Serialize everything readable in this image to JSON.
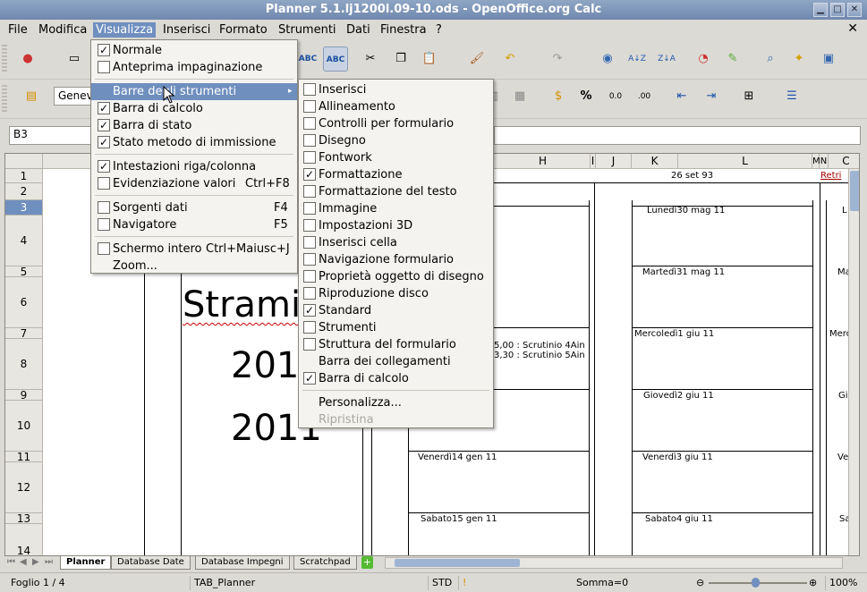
{
  "window": {
    "title": "Planner 5.1.lj1200l.09-10.ods - OpenOffice.org Calc"
  },
  "menubar": {
    "items": [
      "File",
      "Modifica",
      "Visualizza",
      "Inserisci",
      "Formato",
      "Strumenti",
      "Dati",
      "Finestra",
      "?"
    ]
  },
  "formula": {
    "cell_ref": "B3"
  },
  "font_box": {
    "value": "Genev"
  },
  "columns": [
    "H",
    "I",
    "J",
    "K",
    "L",
    "M",
    "N",
    "C"
  ],
  "rows": [
    "1",
    "2",
    "3",
    "4",
    "5",
    "6",
    "7",
    "8",
    "9",
    "10",
    "11",
    "12",
    "13",
    "14"
  ],
  "cells": {
    "date_header": "26 set 93",
    "retri": "Retri",
    "big_text": "Stramin",
    "year1": "2010",
    "year2": "2011",
    "lunedi": "Lunedì30 mag 11",
    "martedi": "Martedì31 mag 11",
    "mercoledi": "Mercoledì1 giu 11",
    "giovedi": "Giovedì2 giu 11",
    "venerdi": "Venerdì3 giu 11",
    "sabato": "Sabato4 giu 11",
    "venerdi_gen": "Venerdì14 gen 11",
    "sabato_gen": "Sabato15 gen 11",
    "scrutinio1": "5,00 : Scrutinio 4Ain",
    "scrutinio2": "3,30 : Scrutinio 5Ain",
    "col_edge": [
      "L",
      "Ma",
      "Merc",
      "Gi",
      "Ve",
      "Sa"
    ]
  },
  "sheet_tabs": [
    "Planner",
    "Database Date",
    "Database Impegni",
    "Scratchpad"
  ],
  "status": {
    "sheet": "Foglio 1 / 4",
    "style": "TAB_Planner",
    "mode": "STD",
    "sum": "Somma=0",
    "zoom": "100%"
  },
  "visualizza_menu": [
    {
      "label": "Normale",
      "checked": true,
      "accel": ""
    },
    {
      "label": "Anteprima impaginazione",
      "checked": false,
      "accel": ""
    },
    {
      "label": "Barre degli strumenti",
      "submenu": true,
      "accel": ""
    },
    {
      "label": "Barra di calcolo",
      "checked": true,
      "accel": ""
    },
    {
      "label": "Barra di stato",
      "checked": true,
      "accel": ""
    },
    {
      "label": "Stato metodo di immissione",
      "checked": true,
      "accel": ""
    },
    {
      "label": "Intestazioni riga/colonna",
      "checked": true,
      "accel": ""
    },
    {
      "label": "Evidenziazione valori",
      "checked": false,
      "accel": "Ctrl+F8"
    },
    {
      "label": "Sorgenti dati",
      "checked": false,
      "accel": "F4"
    },
    {
      "label": "Navigatore",
      "checked": false,
      "accel": "F5"
    },
    {
      "label": "Schermo intero",
      "checked": false,
      "accel": "Ctrl+Maiusc+J"
    },
    {
      "label": "Zoom...",
      "accel": ""
    }
  ],
  "toolbars_submenu": [
    {
      "label": "Inserisci",
      "checked": false
    },
    {
      "label": "Allineamento",
      "checked": false
    },
    {
      "label": "Controlli per formulario",
      "checked": false
    },
    {
      "label": "Disegno",
      "checked": false
    },
    {
      "label": "Fontwork",
      "checked": false
    },
    {
      "label": "Formattazione",
      "checked": true
    },
    {
      "label": "Formattazione del testo",
      "checked": false
    },
    {
      "label": "Immagine",
      "checked": false
    },
    {
      "label": "Impostazioni 3D",
      "checked": false
    },
    {
      "label": "Inserisci cella",
      "checked": false
    },
    {
      "label": "Navigazione formulario",
      "checked": false
    },
    {
      "label": "Proprietà oggetto di disegno",
      "checked": false
    },
    {
      "label": "Riproduzione disco",
      "checked": false
    },
    {
      "label": "Standard",
      "checked": true
    },
    {
      "label": "Strumenti",
      "checked": false
    },
    {
      "label": "Struttura del formulario",
      "checked": false
    },
    {
      "label": "Barra dei collegamenti",
      "checked": null
    },
    {
      "label": "Barra di calcolo",
      "checked": true
    },
    {
      "label": "Personalizza...",
      "checked": null
    },
    {
      "label": "Ripristina",
      "checked": null,
      "disabled": true
    }
  ]
}
